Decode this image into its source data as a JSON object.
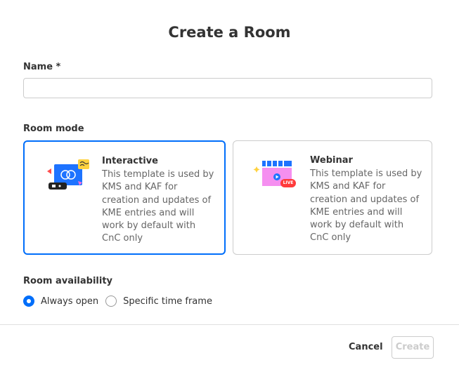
{
  "dialog": {
    "title": "Create a Room"
  },
  "name_field": {
    "label": "Name *",
    "value": "",
    "placeholder": ""
  },
  "room_mode": {
    "label": "Room mode",
    "selected": "Interactive",
    "options": [
      {
        "title": "Interactive",
        "description": "This template is used by KMS and KAF for creation and updates of KME entries and will work by default with CnC only",
        "icon": "interactive-room-icon",
        "selected": true
      },
      {
        "title": "Webinar",
        "description": "This template is used by KMS and KAF for creation and updates of KME entries and will work by default with CnC only",
        "icon": "webinar-room-icon",
        "badge": "LIVE",
        "selected": false
      }
    ]
  },
  "availability": {
    "label": "Room availability",
    "options": [
      {
        "label": "Always open",
        "checked": true
      },
      {
        "label": "Specific time frame",
        "checked": false
      }
    ]
  },
  "footer": {
    "cancel_label": "Cancel",
    "create_label": "Create",
    "create_enabled": false
  },
  "colors": {
    "accent": "#006efa",
    "text": "#333333",
    "muted_text": "#666666",
    "border": "#cccccc",
    "disabled": "#cccccc"
  }
}
